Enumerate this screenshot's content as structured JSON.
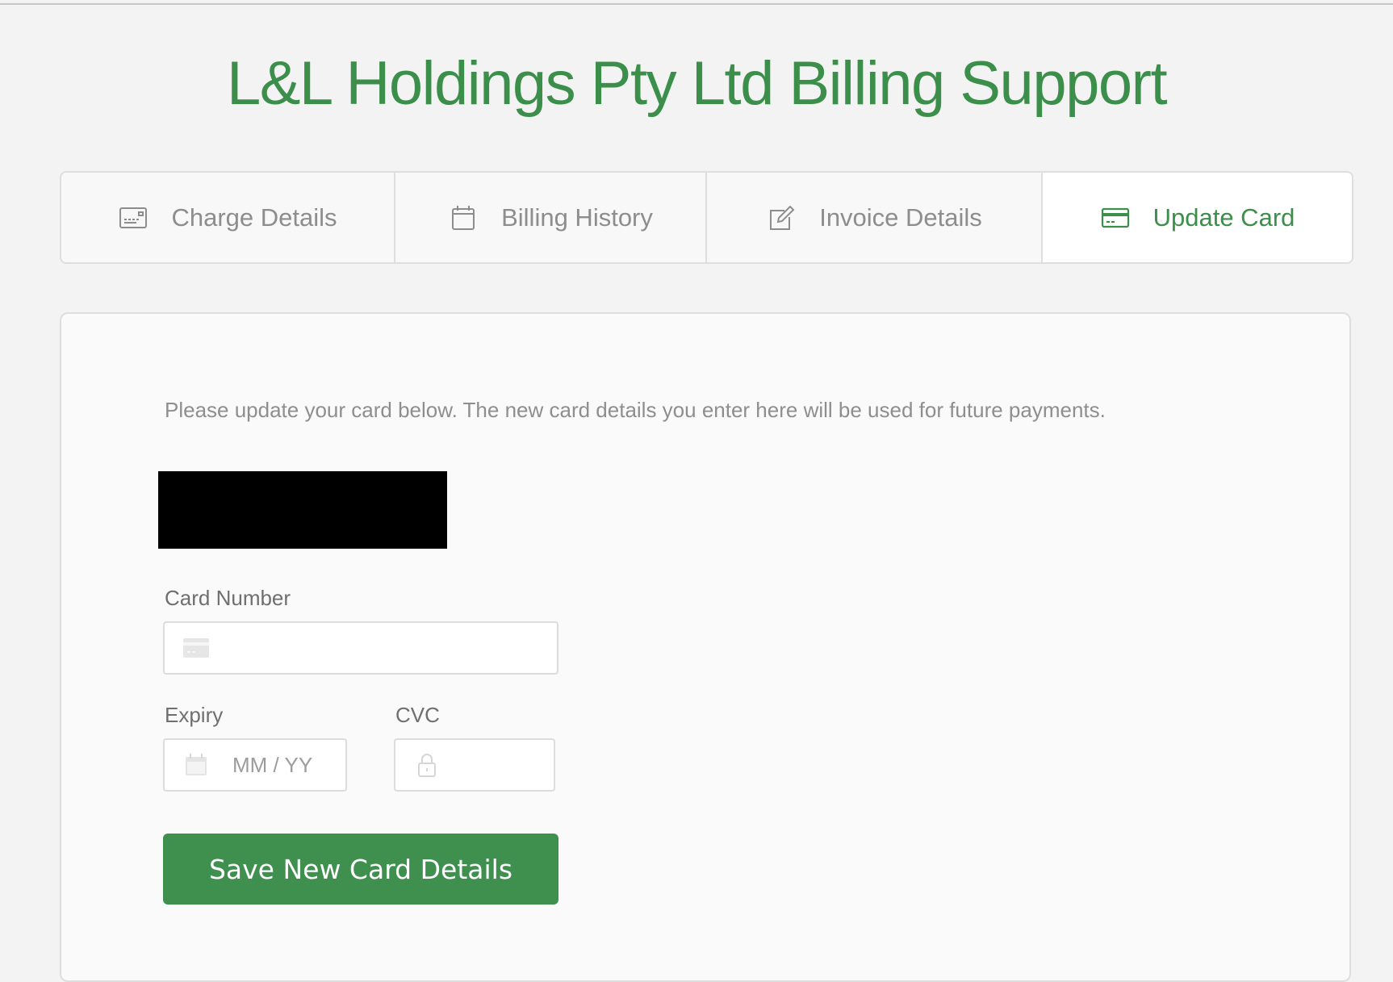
{
  "header": {
    "title": "L&L Holdings Pty Ltd Billing Support"
  },
  "tabs": [
    {
      "label": "Charge Details",
      "icon": "charge-card-icon",
      "active": false
    },
    {
      "label": "Billing History",
      "icon": "calendar-icon",
      "active": false
    },
    {
      "label": "Invoice Details",
      "icon": "edit-icon",
      "active": false
    },
    {
      "label": "Update Card",
      "icon": "credit-card-icon",
      "active": true
    }
  ],
  "form": {
    "intro": "Please update your card below. The new card details you enter here will be used for future payments.",
    "card_number_label": "Card Number",
    "card_number_value": "",
    "expiry_label": "Expiry",
    "expiry_placeholder": "MM / YY",
    "cvc_label": "CVC",
    "cvc_value": "",
    "save_label": "Save New Card Details"
  },
  "colors": {
    "accent": "#3c8f4a",
    "button": "#3f8f4f",
    "muted_text": "#8d8d8d",
    "border": "#dedede"
  }
}
